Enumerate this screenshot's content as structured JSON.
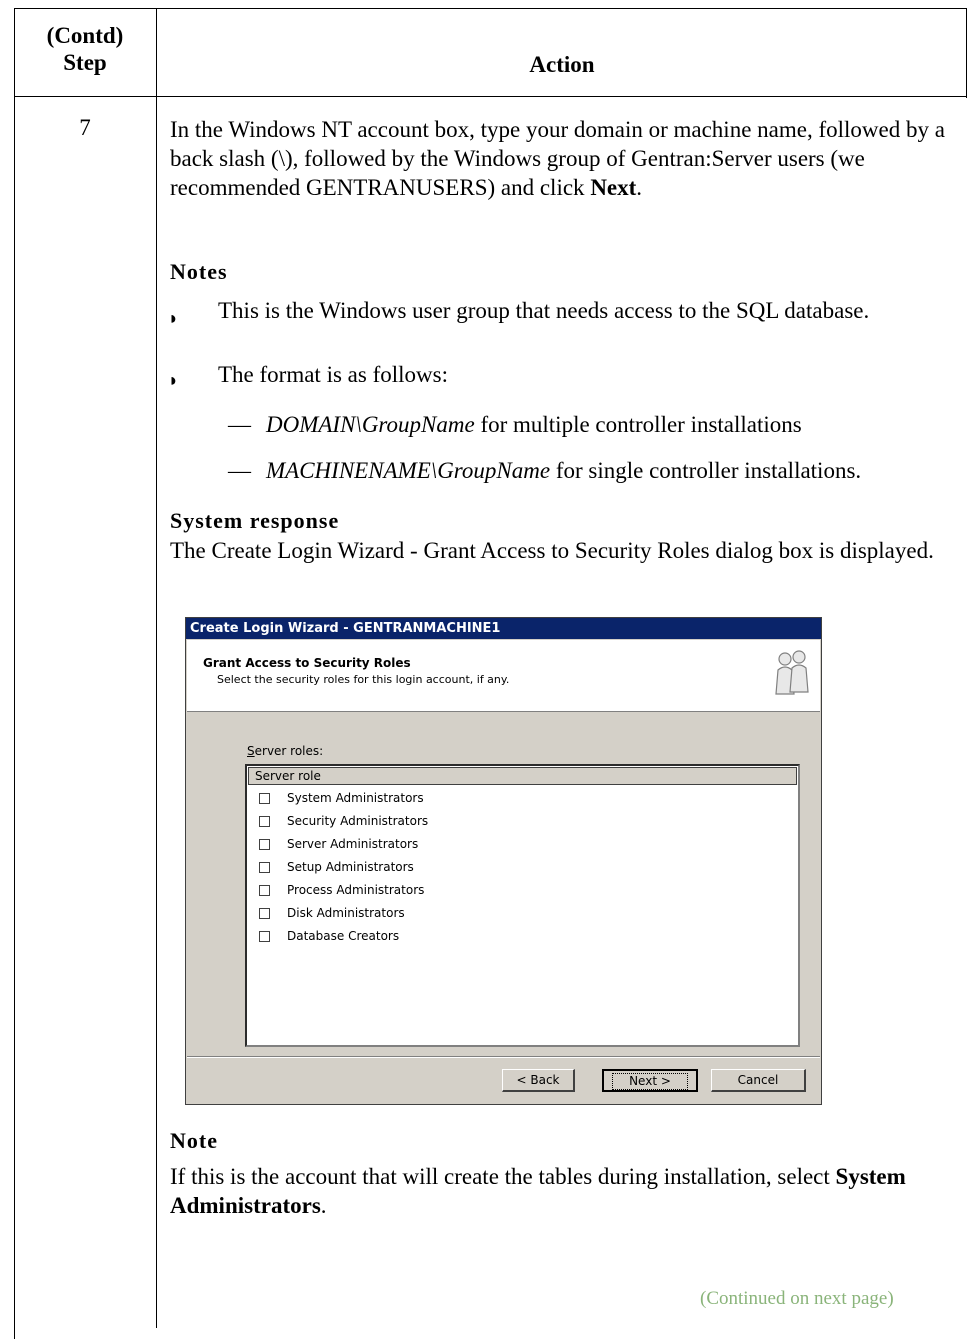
{
  "table": {
    "header_step": "(Contd)\nStep",
    "header_step_line1": "(Contd)",
    "header_step_line2": "Step",
    "header_action": "Action",
    "step_number": "7"
  },
  "action": {
    "para_text": "In the Windows NT account box, type your domain or machine name, followed by a back slash (\\), followed by the Windows group of Gentran:Server users (we recommended GENTRANUSERS) and click ",
    "para_bold": "Next",
    "para_end": ".",
    "notes_heading": "Notes",
    "bullet1": "This is the Windows user group that needs access to the SQL database.",
    "bullet2": "The format is as follows:",
    "sub1_italic": "DOMAIN\\GroupName",
    "sub1_text": " for multiple controller installations",
    "sub2_italic": "MACHINENAME\\GroupName",
    "sub2_text": " for single controller installations.",
    "system_response_heading": "System response",
    "system_response_text": "The Create Login Wizard - Grant Access to Security Roles dialog box is displayed.",
    "note_heading": "Note",
    "note_text": "If this is the account that will create the tables during installation, select ",
    "note_bold": "System Administrators",
    "note_end": ".",
    "continued": "(Continued on next page)"
  },
  "dialog": {
    "title": "Create Login Wizard - GENTRANMACHINE1",
    "heading": "Grant Access to Security Roles",
    "subheading": "Select the security roles for this login account, if any.",
    "icon": "users-icon",
    "server_roles_label": "Server roles:",
    "column_header": "Server role",
    "roles": [
      {
        "label": "System Administrators",
        "checked": false
      },
      {
        "label": "Security Administrators",
        "checked": false
      },
      {
        "label": "Server Administrators",
        "checked": false
      },
      {
        "label": "Setup Administrators",
        "checked": false
      },
      {
        "label": "Process Administrators",
        "checked": false
      },
      {
        "label": "Disk Administrators",
        "checked": false
      },
      {
        "label": "Database Creators",
        "checked": false
      }
    ],
    "back_button": "< Back",
    "next_button": "Next >",
    "cancel_button": "Cancel"
  }
}
